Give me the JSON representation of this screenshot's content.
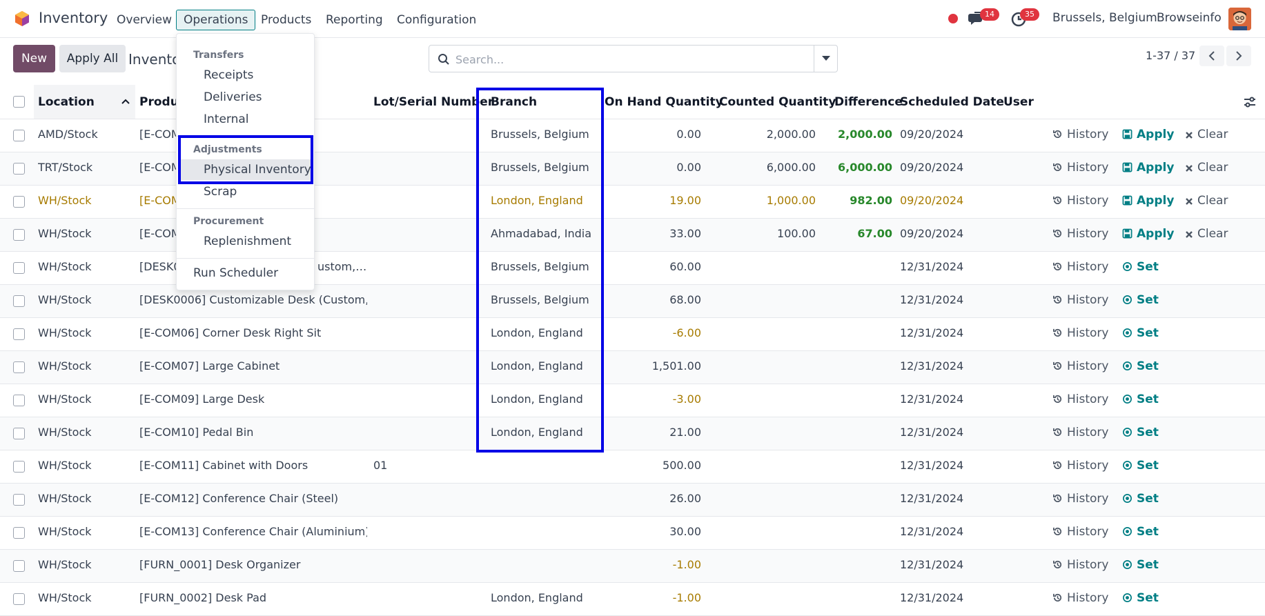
{
  "navbar": {
    "app_name": "Inventory",
    "menus": [
      "Overview",
      "Operations",
      "Products",
      "Reporting",
      "Configuration"
    ],
    "active_menu": "Operations",
    "messages_count": "14",
    "activities_count": "35",
    "company": "Brussels, Belgium",
    "user": "Browseinfo"
  },
  "controls": {
    "new_label": "New",
    "apply_all_label": "Apply All",
    "breadcrumb": "Inventory",
    "search_placeholder": "Search...",
    "pager": "1-37 / 37"
  },
  "dropdown": {
    "sections": [
      {
        "header": "Transfers",
        "items": [
          "Receipts",
          "Deliveries",
          "Internal"
        ]
      },
      {
        "header": "Adjustments",
        "items": [
          "Physical Inventory",
          "Scrap"
        ]
      },
      {
        "header": "Procurement",
        "items": [
          "Replenishment"
        ]
      }
    ],
    "footer_item": "Run Scheduler",
    "highlighted_item": "Physical Inventory"
  },
  "table": {
    "columns": [
      "Location",
      "Product",
      "Lot/Serial Number",
      "Branch",
      "On Hand Quantity",
      "Counted Quantity",
      "Difference",
      "Scheduled Date",
      "User"
    ],
    "actions": {
      "history": "History",
      "apply": "Apply",
      "clear": "Clear",
      "set": "Set"
    },
    "rows": [
      {
        "location": "AMD/Stock",
        "product": "[E-COM",
        "lot": "",
        "branch": "Brussels, Belgium",
        "on_hand": "0.00",
        "counted": "2,000.00",
        "difference": "2,000.00",
        "date": "09/20/2024",
        "mode": "apply"
      },
      {
        "location": "TRT/Stock",
        "product": "[E-COM",
        "lot": "",
        "branch": "Brussels, Belgium",
        "on_hand": "0.00",
        "counted": "6,000.00",
        "difference": "6,000.00",
        "date": "09/20/2024",
        "mode": "apply"
      },
      {
        "location": "WH/Stock",
        "product": "[E-COM",
        "lot": "",
        "branch": "London, England",
        "on_hand": "19.00",
        "counted": "1,000.00",
        "difference": "982.00",
        "date": "09/20/2024",
        "mode": "apply",
        "warn": true
      },
      {
        "location": "WH/Stock",
        "product": "[E-COM",
        "lot": "",
        "branch": "Ahmadabad, India",
        "on_hand": "33.00",
        "counted": "100.00",
        "difference": "67.00",
        "date": "09/20/2024",
        "mode": "apply"
      },
      {
        "location": "WH/Stock",
        "product": "[DESK0",
        "product_tail": "ustom,…",
        "lot": "",
        "branch": "Brussels, Belgium",
        "on_hand": "60.00",
        "counted": "",
        "difference": "",
        "date": "12/31/2024",
        "mode": "set"
      },
      {
        "location": "WH/Stock",
        "product": "[DESK0006] Customizable Desk (Custom,…",
        "lot": "",
        "branch": "Brussels, Belgium",
        "on_hand": "68.00",
        "counted": "",
        "difference": "",
        "date": "12/31/2024",
        "mode": "set"
      },
      {
        "location": "WH/Stock",
        "product": "[E-COM06] Corner Desk Right Sit",
        "lot": "",
        "branch": "London, England",
        "on_hand": "-6.00",
        "counted": "",
        "difference": "",
        "date": "12/31/2024",
        "mode": "set",
        "neg": true
      },
      {
        "location": "WH/Stock",
        "product": "[E-COM07] Large Cabinet",
        "lot": "",
        "branch": "London, England",
        "on_hand": "1,501.00",
        "counted": "",
        "difference": "",
        "date": "12/31/2024",
        "mode": "set"
      },
      {
        "location": "WH/Stock",
        "product": "[E-COM09] Large Desk",
        "lot": "",
        "branch": "London, England",
        "on_hand": "-3.00",
        "counted": "",
        "difference": "",
        "date": "12/31/2024",
        "mode": "set",
        "neg": true
      },
      {
        "location": "WH/Stock",
        "product": "[E-COM10] Pedal Bin",
        "lot": "",
        "branch": "London, England",
        "on_hand": "21.00",
        "counted": "",
        "difference": "",
        "date": "12/31/2024",
        "mode": "set"
      },
      {
        "location": "WH/Stock",
        "product": "[E-COM11] Cabinet with Doors",
        "lot": "01",
        "branch": "",
        "on_hand": "500.00",
        "counted": "",
        "difference": "",
        "date": "12/31/2024",
        "mode": "set"
      },
      {
        "location": "WH/Stock",
        "product": "[E-COM12] Conference Chair (Steel)",
        "lot": "",
        "branch": "",
        "on_hand": "26.00",
        "counted": "",
        "difference": "",
        "date": "12/31/2024",
        "mode": "set"
      },
      {
        "location": "WH/Stock",
        "product": "[E-COM13] Conference Chair (Aluminium)",
        "lot": "",
        "branch": "",
        "on_hand": "30.00",
        "counted": "",
        "difference": "",
        "date": "12/31/2024",
        "mode": "set"
      },
      {
        "location": "WH/Stock",
        "product": "[FURN_0001] Desk Organizer",
        "lot": "",
        "branch": "",
        "on_hand": "-1.00",
        "counted": "",
        "difference": "",
        "date": "12/31/2024",
        "mode": "set",
        "neg": true
      },
      {
        "location": "WH/Stock",
        "product": "[FURN_0002] Desk Pad",
        "lot": "",
        "branch": "London, England",
        "on_hand": "-1.00",
        "counted": "",
        "difference": "",
        "date": "12/31/2024",
        "mode": "set",
        "neg": true
      }
    ]
  },
  "colors": {
    "brand": "#714b67",
    "accent": "#017e84",
    "highlight": "#0000e6",
    "positive": "#28882b",
    "warning": "#a77b00"
  }
}
